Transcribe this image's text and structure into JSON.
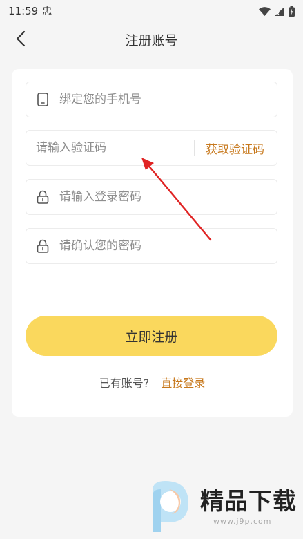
{
  "status_bar": {
    "time": "11:59",
    "left_glyph": "忠",
    "icons": [
      "wifi-icon",
      "signal-icon",
      "battery-icon"
    ]
  },
  "header": {
    "title": "注册账号",
    "back_icon": "chevron-left-icon"
  },
  "form": {
    "phone": {
      "placeholder": "绑定您的手机号",
      "value": "",
      "icon": "phone-icon"
    },
    "code": {
      "placeholder": "请输入验证码",
      "value": "",
      "get_code_label": "获取验证码"
    },
    "password": {
      "placeholder": "请输入登录密码",
      "value": "",
      "icon": "lock-icon"
    },
    "confirm_password": {
      "placeholder": "请确认您的密码",
      "value": "",
      "icon": "lock-icon"
    },
    "submit_label": "立即注册"
  },
  "footer": {
    "prompt": "已有账号?",
    "login_link": "直接登录"
  },
  "watermark": {
    "brand": "精品下载",
    "url": "www.j9p.com"
  },
  "colors": {
    "accent": "#c7781c",
    "button": "#fad85d",
    "annotation_arrow": "#e02424",
    "background": "#f5f5f5"
  }
}
